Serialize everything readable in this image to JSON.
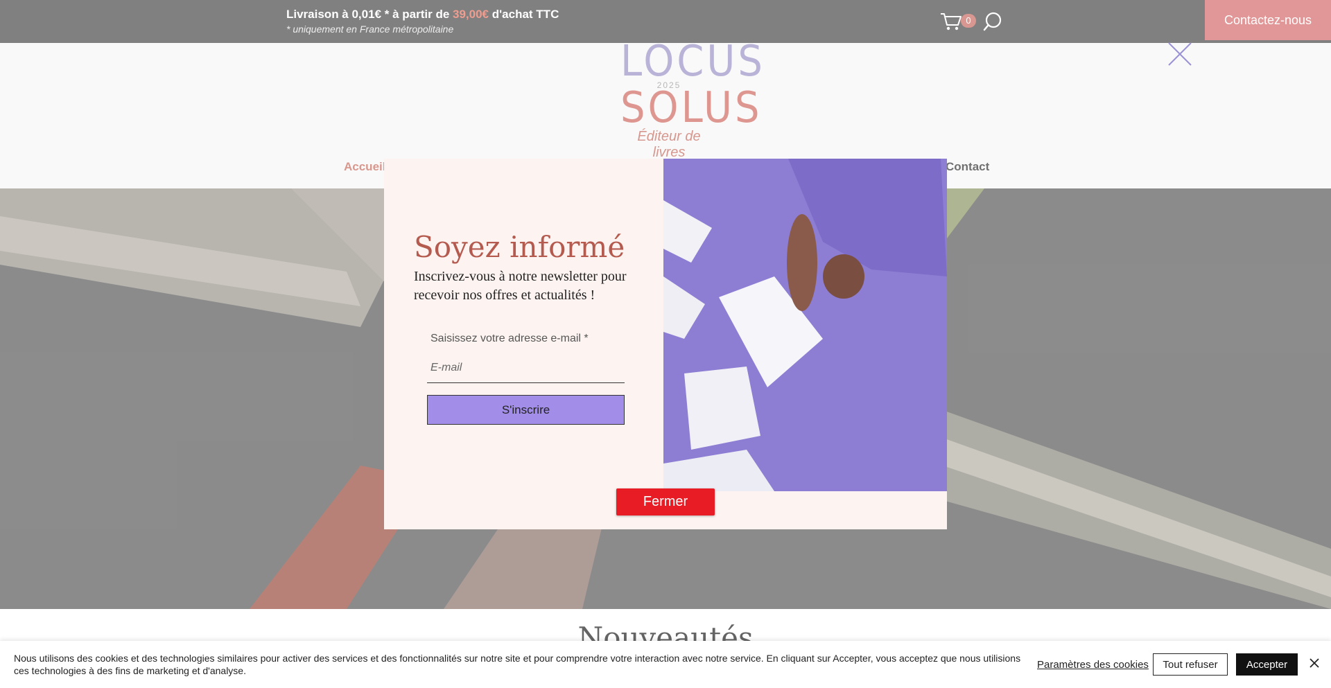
{
  "topbar": {
    "shipping_prefix": "Livraison à 0,01€ * à partir de ",
    "shipping_amount": "39,00€",
    "shipping_suffix": " d'achat TTC",
    "shipping_note": "* uniquement en France métropolitaine",
    "cart_count": "0",
    "contact_label": "Contactez-nous"
  },
  "header": {
    "logo_line1": "LOCUS",
    "logo_year": "2025",
    "logo_line2": "SOLUS",
    "logo_tagline": "Éditeur de livres",
    "nav": {
      "home": "Accueil",
      "contact": "Contact"
    }
  },
  "section": {
    "title": "Nouveautés"
  },
  "modal": {
    "title": "Soyez informé",
    "subtitle": "Inscrivez-vous à notre newsletter pour recevoir nos offres et actualités !",
    "email_label": "Saisissez votre adresse e-mail *",
    "email_placeholder": "E-mail",
    "subscribe_label": "S'inscrire",
    "close_label": "Fermer"
  },
  "cookie": {
    "text": "Nous utilisons des cookies et des technologies similaires pour activer des services et des fonctionnalités sur notre site et pour comprendre votre interaction avec notre service. En cliquant sur Accepter, vous acceptez que nous utilisions ces technologies à des fins de marketing et d'analyse.",
    "settings_label": "Paramètres des cookies",
    "refuse_label": "Tout refuser",
    "accept_label": "Accepter"
  },
  "colors": {
    "topbar_bg": "#4a4a4a",
    "accent": "#d46a6a",
    "modal_bg": "#fdf4f1",
    "modal_title": "#b45a4e",
    "subscribe_bg": "#a28de8",
    "close_btn": "#e81c24"
  }
}
